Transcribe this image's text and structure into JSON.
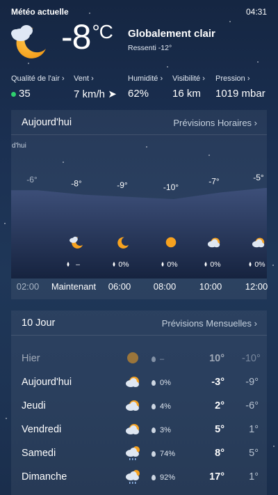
{
  "header": {
    "title": "Météo actuelle",
    "time": "04:31"
  },
  "current": {
    "temp": "-8",
    "unit": "°C",
    "condition": "Globalement clair",
    "feels_like": "Ressenti -12°",
    "icon": "cloud-moon-icon"
  },
  "metrics": [
    {
      "label": "Qualité de l'air",
      "value": "35",
      "status_color": "#2fd06e"
    },
    {
      "label": "Vent",
      "value": "7 km/h"
    },
    {
      "label": "Humidité",
      "value": "62%"
    },
    {
      "label": "Visibilité",
      "value": "16 km"
    },
    {
      "label": "Pression",
      "value": "1019 mbar"
    }
  ],
  "hourly": {
    "title": "Aujourd'hui",
    "link": "Prévisions Horaires",
    "partial_label": "d'hui",
    "items": [
      {
        "time": "02:00",
        "temp": "-6°",
        "precip": "",
        "icon": "",
        "past": true
      },
      {
        "time": "Maintenant",
        "temp": "-8°",
        "precip": "–",
        "icon": "cloud-moon-icon"
      },
      {
        "time": "06:00",
        "temp": "-9°",
        "precip": "0%",
        "icon": "moon-icon"
      },
      {
        "time": "08:00",
        "temp": "-10°",
        "precip": "0%",
        "icon": "sun-icon"
      },
      {
        "time": "10:00",
        "temp": "-7°",
        "precip": "0%",
        "icon": "cloud-sun-icon"
      },
      {
        "time": "12:00",
        "temp": "-5°",
        "precip": "0%",
        "icon": "cloud-sun-icon"
      }
    ]
  },
  "daily": {
    "title": "10 Jour",
    "link": "Prévisions Mensuelles",
    "days": [
      {
        "name": "Hier",
        "precip": "–",
        "max": "10°",
        "min": "-10°",
        "icon": "sun-icon",
        "past": true
      },
      {
        "name": "Aujourd'hui",
        "precip": "0%",
        "max": "-3°",
        "min": "-9°",
        "icon": "cloud-sun-icon"
      },
      {
        "name": "Jeudi",
        "precip": "4%",
        "max": "2°",
        "min": "-6°",
        "icon": "cloud-sun-icon"
      },
      {
        "name": "Vendredi",
        "precip": "3%",
        "max": "5°",
        "min": "1°",
        "icon": "cloud-sun-icon"
      },
      {
        "name": "Samedi",
        "precip": "74%",
        "max": "8°",
        "min": "5°",
        "icon": "cloud-rain-icon"
      },
      {
        "name": "Dimanche",
        "precip": "92%",
        "max": "17°",
        "min": "1°",
        "icon": "cloud-rain-icon"
      }
    ]
  }
}
